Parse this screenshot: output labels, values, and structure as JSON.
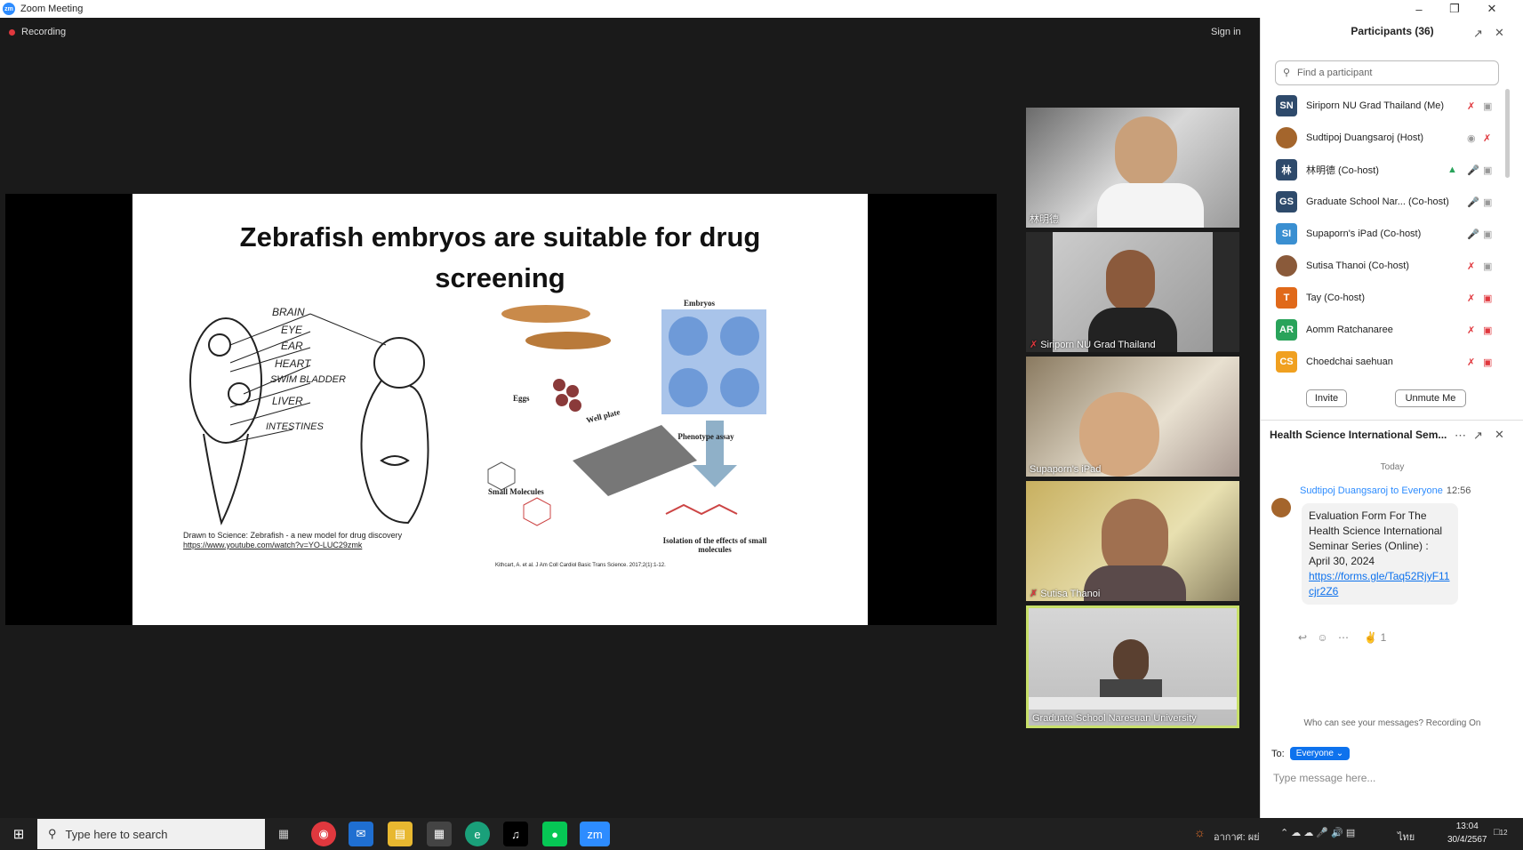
{
  "window": {
    "title": "Zoom Meeting",
    "app_logo": "zm"
  },
  "stage": {
    "recording_label": "Recording",
    "sign_in": "Sign in"
  },
  "slide": {
    "title_line1": "Zebrafish embryos are suitable for drug",
    "title_line2": "screening",
    "labels": [
      "BRAIN",
      "EYE",
      "EAR",
      "HEART",
      "SWIM BLADDER",
      "LIVER",
      "INTESTINES",
      "Embryos",
      "Eggs",
      "Well plate",
      "Phenotype assay",
      "Small Molecules",
      "Isolation of the effects of small molecules"
    ],
    "credit_line1": "Drawn to Science: Zebrafish - a new model for drug discovery",
    "credit_line2": "https://www.youtube.com/watch?v=YO-LUC29zmk",
    "citation": "Kithcart, A. et al. J Am Coll Cardiol Basic Trans Science. 2017;2(1):1-12."
  },
  "videos": [
    {
      "name": "林明德",
      "muted": false
    },
    {
      "name": "Siriporn NU Grad Thailand",
      "muted": true
    },
    {
      "name": "Supaporn's iPad",
      "muted": false
    },
    {
      "name": "Sutisa Thanoi",
      "muted": true
    },
    {
      "name": "Graduate School Naresuan University",
      "muted": false
    }
  ],
  "participants": {
    "header": "Participants (36)",
    "search_placeholder": "Find a participant",
    "list": [
      {
        "initials": "SN",
        "name": "Siriporn NU Grad Thailand (Me)",
        "color": "#2e4a6b"
      },
      {
        "initials": "",
        "name": "Sudtipoj Duangsaroj (Host)",
        "color": "#a4652c"
      },
      {
        "initials": "林",
        "name": "林明德 (Co-host)",
        "color": "#2e4a6b"
      },
      {
        "initials": "GS",
        "name": "Graduate School Nar... (Co-host)",
        "color": "#2e4a6b"
      },
      {
        "initials": "SI",
        "name": "Supaporn's iPad (Co-host)",
        "color": "#3a8fd1"
      },
      {
        "initials": "",
        "name": "Sutisa Thanoi (Co-host)",
        "color": "#8a5a3a"
      },
      {
        "initials": "T",
        "name": "Tay (Co-host)",
        "color": "#e0691a"
      },
      {
        "initials": "AR",
        "name": "Aomm Ratchanaree",
        "color": "#29a35a"
      },
      {
        "initials": "CS",
        "name": "Choedchai saehuan",
        "color": "#f0a020"
      }
    ],
    "invite": "Invite",
    "unmute_me": "Unmute Me"
  },
  "chat": {
    "title": "Health Science International Sem...",
    "day": "Today",
    "from": "Sudtipoj Duangsaroj to Everyone",
    "time": "12:56",
    "message": "Evaluation Form For The Health Science International Seminar Series (Online) : April 30, 2024",
    "link": "https://forms.gle/Taq52RjyF11cjr2Z6",
    "reaction_count": "1",
    "who_can_see": "Who can see your messages? Recording On",
    "to_label": "To:",
    "to_value": "Everyone",
    "input_placeholder": "Type message here..."
  },
  "taskbar": {
    "search_placeholder": "Type here to search",
    "weather": "อากาศ: ผย่",
    "lang": "ไทย",
    "time": "13:04",
    "date": "30/4/2567",
    "notifications": "12"
  }
}
